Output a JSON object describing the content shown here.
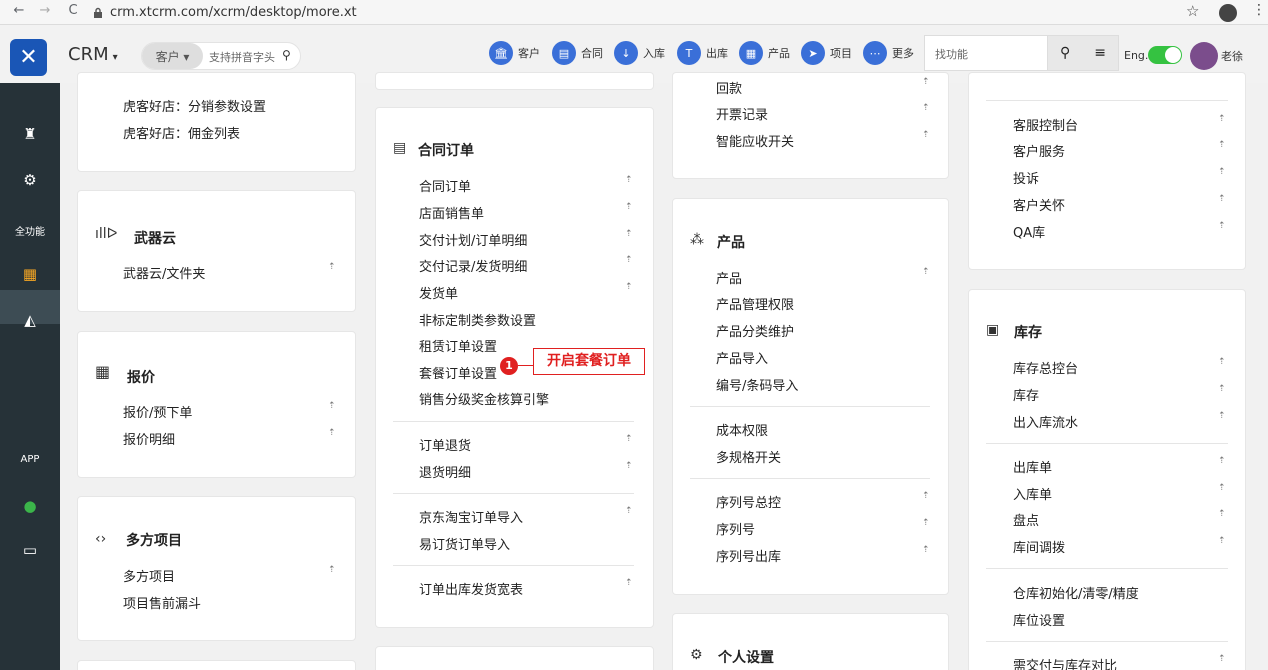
{
  "browser": {
    "back": "←",
    "forward": "→",
    "reload": "C",
    "url": "crm.xtcrm.com/xcrm/desktop/more.xt",
    "star": "☆",
    "menu": "⋮"
  },
  "header": {
    "app_name": "CRM",
    "app_caret": "▾",
    "customer_selector": "客户 ▾",
    "search_placeholder": "支持拼音字头",
    "nav": [
      {
        "icon": "building-icon",
        "glyph": "🏛",
        "label": "客户"
      },
      {
        "icon": "document-icon",
        "glyph": "▤",
        "label": "合同"
      },
      {
        "icon": "inbound-icon",
        "glyph": "↓",
        "label": "入库"
      },
      {
        "icon": "outbound-icon",
        "glyph": "T",
        "label": "出库"
      },
      {
        "icon": "grid-icon",
        "glyph": "▦",
        "label": "产品"
      },
      {
        "icon": "rocket-icon",
        "glyph": "➤",
        "label": "项目"
      },
      {
        "icon": "more-icon",
        "glyph": "⋯",
        "label": "更多"
      }
    ],
    "function_search_placeholder": "找功能",
    "lang_label": "Eng.",
    "user_name": "老徐"
  },
  "sidebar": [
    {
      "icon": "castle-icon",
      "glyph": "♜",
      "label": ""
    },
    {
      "icon": "gears-icon",
      "glyph": "⚙",
      "label": ""
    },
    {
      "icon": "",
      "glyph": "",
      "label": "全功能"
    },
    {
      "icon": "windows-icon",
      "glyph": "▦",
      "label": ""
    },
    {
      "icon": "area-chart-icon",
      "glyph": "◭",
      "label": ""
    },
    {
      "icon": "",
      "glyph": "",
      "label": "APP"
    },
    {
      "icon": "wechat-icon",
      "glyph": "●",
      "label": ""
    },
    {
      "icon": "monitor-icon",
      "glyph": "▭",
      "label": ""
    }
  ],
  "col1": {
    "card1": {
      "links": [
        "虎客好店：分销参数设置",
        "虎客好店：佣金列表"
      ]
    },
    "weapon_cloud": {
      "title": "武器云",
      "links": [
        "武器云/文件夹"
      ]
    },
    "quote": {
      "title": "报价",
      "links": [
        "报价/预下单",
        "报价明细"
      ]
    },
    "multi_project": {
      "title": "多方项目",
      "links": [
        "多方项目",
        "项目售前漏斗"
      ]
    }
  },
  "col2": {
    "contract_order": {
      "title": "合同订单",
      "group1": [
        "合同订单",
        "店面销售单",
        "交付计划/订单明细",
        "交付记录/发货明细",
        "发货单",
        "非标定制类参数设置",
        "租赁订单设置",
        "套餐订单设置",
        "销售分级奖金核算引擎"
      ],
      "group2": [
        "订单退货",
        "退货明细"
      ],
      "group3": [
        "京东淘宝订单导入",
        "易订货订单导入"
      ],
      "group4": [
        "订单出库发货宽表"
      ]
    }
  },
  "col3": {
    "finance": {
      "links": [
        "回款",
        "开票记录",
        "智能应收开关"
      ]
    },
    "product": {
      "title": "产品",
      "group1": [
        "产品",
        "产品管理权限",
        "产品分类维护",
        "产品导入",
        "编号/条码导入"
      ],
      "group2": [
        "成本权限",
        "多规格开关"
      ],
      "group3": [
        "序列号总控",
        "序列号",
        "序列号出库"
      ]
    },
    "personal": {
      "title": "个人设置"
    }
  },
  "col4": {
    "service": {
      "links": [
        "客服控制台",
        "客户服务",
        "投诉",
        "客户关怀",
        "QA库"
      ]
    },
    "inventory": {
      "title": "库存",
      "group1": [
        "库存总控台",
        "库存",
        "出入库流水"
      ],
      "group2": [
        "出库单",
        "入库单",
        "盘点",
        "库间调拨"
      ],
      "group3": [
        "仓库初始化/清零/精度",
        "库位设置"
      ],
      "group4": [
        "需交付与库存对比"
      ]
    }
  },
  "annotation": {
    "number": "1",
    "text": "开启套餐订单"
  },
  "pin_glyph": "⇡"
}
